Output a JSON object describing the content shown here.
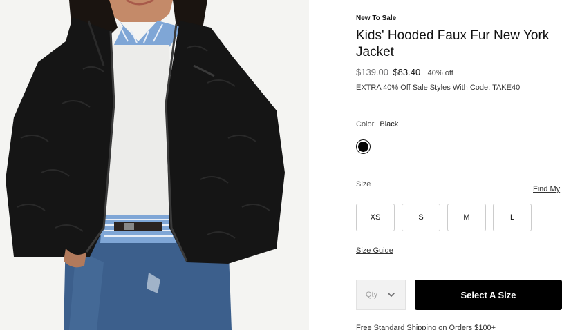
{
  "product": {
    "badge": "New To Sale",
    "title": "Kids' Hooded Faux Fur New York Jacket",
    "price_original": "$139.00",
    "price_sale": "$83.40",
    "discount": "40% off",
    "promo": "EXTRA 40% Off Sale Styles With Code: TAKE40"
  },
  "color": {
    "label": "Color",
    "value": "Black",
    "swatch_hex": "#050505"
  },
  "size": {
    "label": "Size",
    "find_my_size": "Find My",
    "options": [
      "XS",
      "S",
      "M",
      "L"
    ],
    "guide_label": "Size Guide"
  },
  "purchase": {
    "qty_placeholder": "Qty",
    "cta_label": "Select A Size",
    "shipping_note": "Free Standard Shipping on Orders $100+"
  }
}
